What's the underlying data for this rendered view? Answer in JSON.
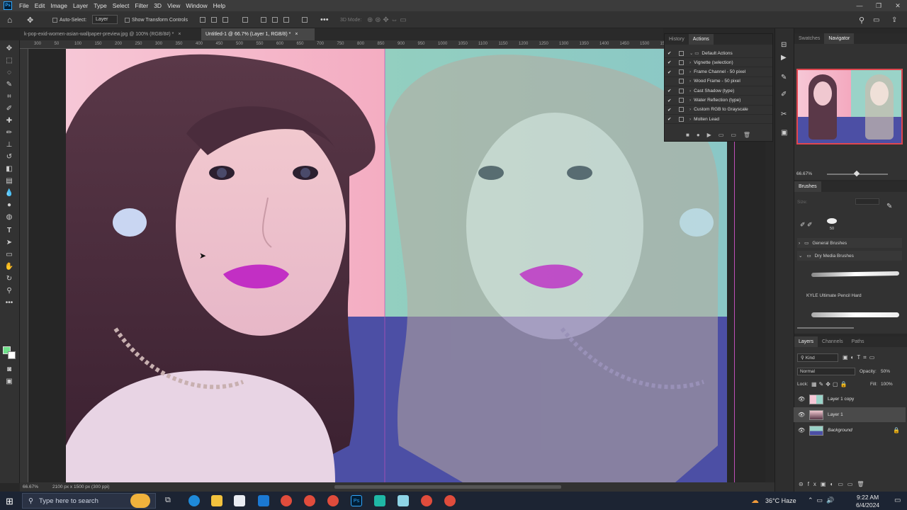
{
  "menubar": {
    "logo": "Ps",
    "items": [
      "File",
      "Edit",
      "Image",
      "Layer",
      "Type",
      "Select",
      "Filter",
      "3D",
      "View",
      "Window",
      "Help"
    ]
  },
  "options": {
    "auto_select": "Auto-Select:",
    "layer_select": "Layer",
    "show_transform": "Show Transform Controls",
    "mode_3d": "3D Mode:"
  },
  "tabs": [
    {
      "label": "k-pop-exid-women-asian-wallpaper-preview.jpg @ 100% (RGB/8#) *",
      "close": "×"
    },
    {
      "label": "Untitled-1 @ 66.7% (Layer 1, RGB/8) *",
      "close": "×"
    }
  ],
  "ruler": [
    "300",
    "50",
    "100",
    "150",
    "200",
    "250",
    "300",
    "350",
    "400",
    "450",
    "500",
    "550",
    "600",
    "650",
    "700",
    "750",
    "800",
    "850",
    "900",
    "950",
    "1000",
    "1050",
    "1100",
    "1150",
    "1200",
    "1250",
    "1300",
    "1350",
    "1400",
    "1450",
    "1500",
    "1550",
    "1600",
    "1650",
    "1700",
    "1750",
    "1800",
    "850"
  ],
  "status": {
    "zoom": "66.67%",
    "doc_size": "2100 px x 1500 px (300 ppi)"
  },
  "history_panel": {
    "tabs": [
      "History",
      "Actions"
    ],
    "actions": [
      {
        "label": "Default Actions",
        "checked": true,
        "folder": true
      },
      {
        "label": "Vignette (selection)",
        "checked": true
      },
      {
        "label": "Frame Channel - 50 pixel",
        "checked": true
      },
      {
        "label": "Wood Frame - 50 pixel",
        "checked": false
      },
      {
        "label": "Cast Shadow (type)",
        "checked": true
      },
      {
        "label": "Water Reflection (type)",
        "checked": true
      },
      {
        "label": "Custom RGB to Grayscale",
        "checked": true
      },
      {
        "label": "Molten Lead",
        "checked": true
      }
    ]
  },
  "swatches_panel": {
    "tabs": [
      "Swatches",
      "Navigator"
    ],
    "zoom": "66.67%"
  },
  "brushes_panel": {
    "title": "Brushes",
    "size_label": "Size:",
    "brush_size": "50",
    "groups": [
      "General Brushes",
      "Dry Media Brushes"
    ],
    "brush_name": "KYLE Ultimate Pencil Hard"
  },
  "layers_panel": {
    "tabs": [
      "Layers",
      "Channels",
      "Paths"
    ],
    "kind": "Kind",
    "blend": "Normal",
    "opacity_label": "Opacity:",
    "opacity": "50%",
    "lock_label": "Lock:",
    "fill_label": "Fill:",
    "fill": "100%",
    "layers": [
      {
        "name": "Layer 1 copy",
        "selected": false
      },
      {
        "name": "Layer 1",
        "selected": true
      },
      {
        "name": "Background",
        "selected": false
      }
    ]
  },
  "taskbar": {
    "search_placeholder": "Type here to search",
    "weather": "36°C  Haze",
    "time": "9:22 AM",
    "date": "6/4/2024"
  },
  "colors": {
    "accent": "#31a8ff",
    "canvas_blue": "#4c4fa5",
    "lip": "#c22fc4"
  }
}
